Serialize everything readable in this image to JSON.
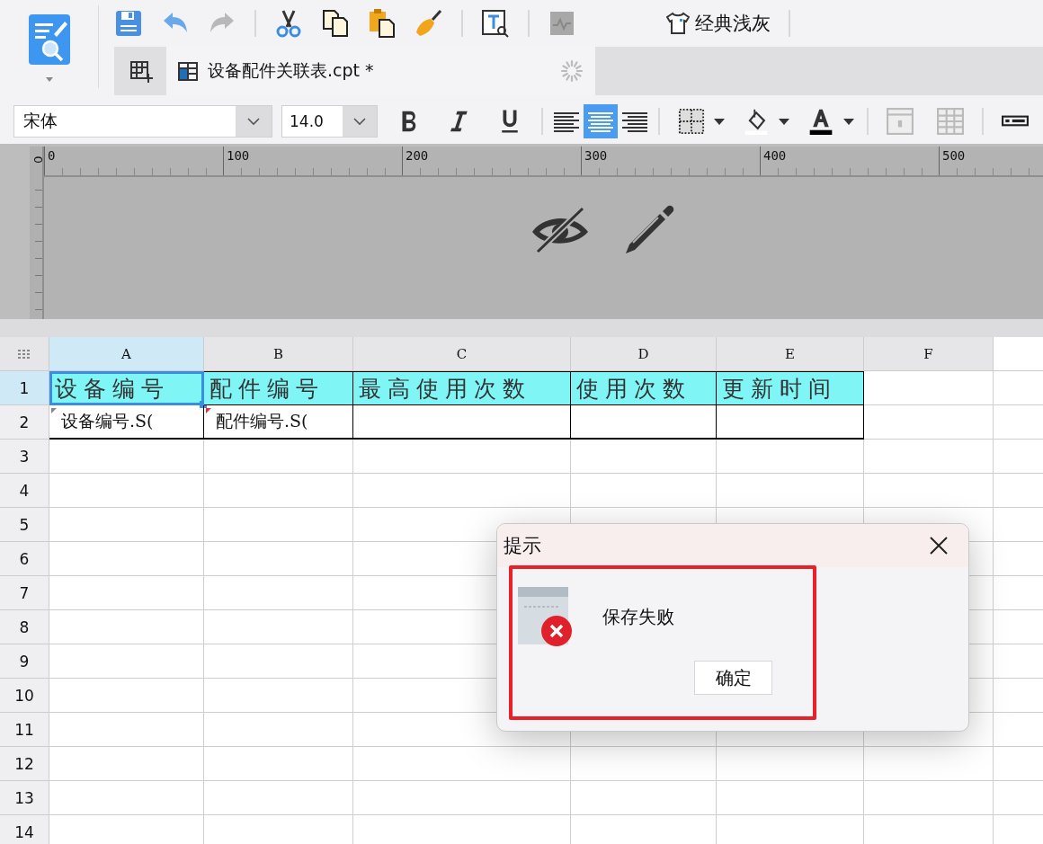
{
  "toolbar": {
    "theme_button": "经典浅灰"
  },
  "tabs": [
    {
      "label": "设备配件关联表.cpt *",
      "selected": true
    }
  ],
  "format_bar": {
    "font": "宋体",
    "size": "14.0",
    "alignment": [
      {
        "kind": "left",
        "selected": false
      },
      {
        "kind": "center",
        "selected": true
      },
      {
        "kind": "right",
        "selected": false
      }
    ]
  },
  "ruler": {
    "ticks": [
      "0",
      "100",
      "200",
      "300",
      "400",
      "500"
    ],
    "vertical_tick": "0"
  },
  "sheet": {
    "columns": [
      {
        "label": "A",
        "selected": true
      },
      {
        "label": "B",
        "selected": false
      },
      {
        "label": "C",
        "selected": false
      },
      {
        "label": "D",
        "selected": false
      },
      {
        "label": "E",
        "selected": false
      },
      {
        "label": "F",
        "selected": false
      }
    ],
    "rows": [
      {
        "label": "1",
        "selected": true,
        "cells": [
          {
            "text": "设备编号",
            "kind": "header",
            "selected": true
          },
          {
            "text": "配件编号",
            "kind": "header",
            "selected": false
          },
          {
            "text": "最高使用次数",
            "kind": "header",
            "selected": false
          },
          {
            "text": "使用次数",
            "kind": "header",
            "selected": false
          },
          {
            "text": "更新时间",
            "kind": "header",
            "selected": false
          }
        ]
      },
      {
        "label": "2",
        "selected": false,
        "cells": [
          {
            "text": "设备编号.S(",
            "kind": "field",
            "selected": false
          },
          {
            "text": "配件编号.S(",
            "kind": "field",
            "selected": false
          },
          {
            "kind": "empty",
            "selected": false
          },
          {
            "kind": "empty",
            "selected": false
          },
          {
            "kind": "empty",
            "selected": false
          }
        ]
      },
      {
        "label": "3",
        "selected": false
      },
      {
        "label": "4",
        "selected": false
      },
      {
        "label": "5",
        "selected": false
      },
      {
        "label": "6",
        "selected": false
      },
      {
        "label": "7",
        "selected": false
      },
      {
        "label": "8",
        "selected": false
      },
      {
        "label": "9",
        "selected": false
      },
      {
        "label": "10",
        "selected": false
      },
      {
        "label": "11",
        "selected": false
      },
      {
        "label": "12",
        "selected": false
      },
      {
        "label": "13",
        "selected": false
      },
      {
        "label": "14",
        "selected": false
      }
    ]
  },
  "dialog": {
    "title": "提示",
    "message": "保存失败",
    "button": "确定"
  }
}
